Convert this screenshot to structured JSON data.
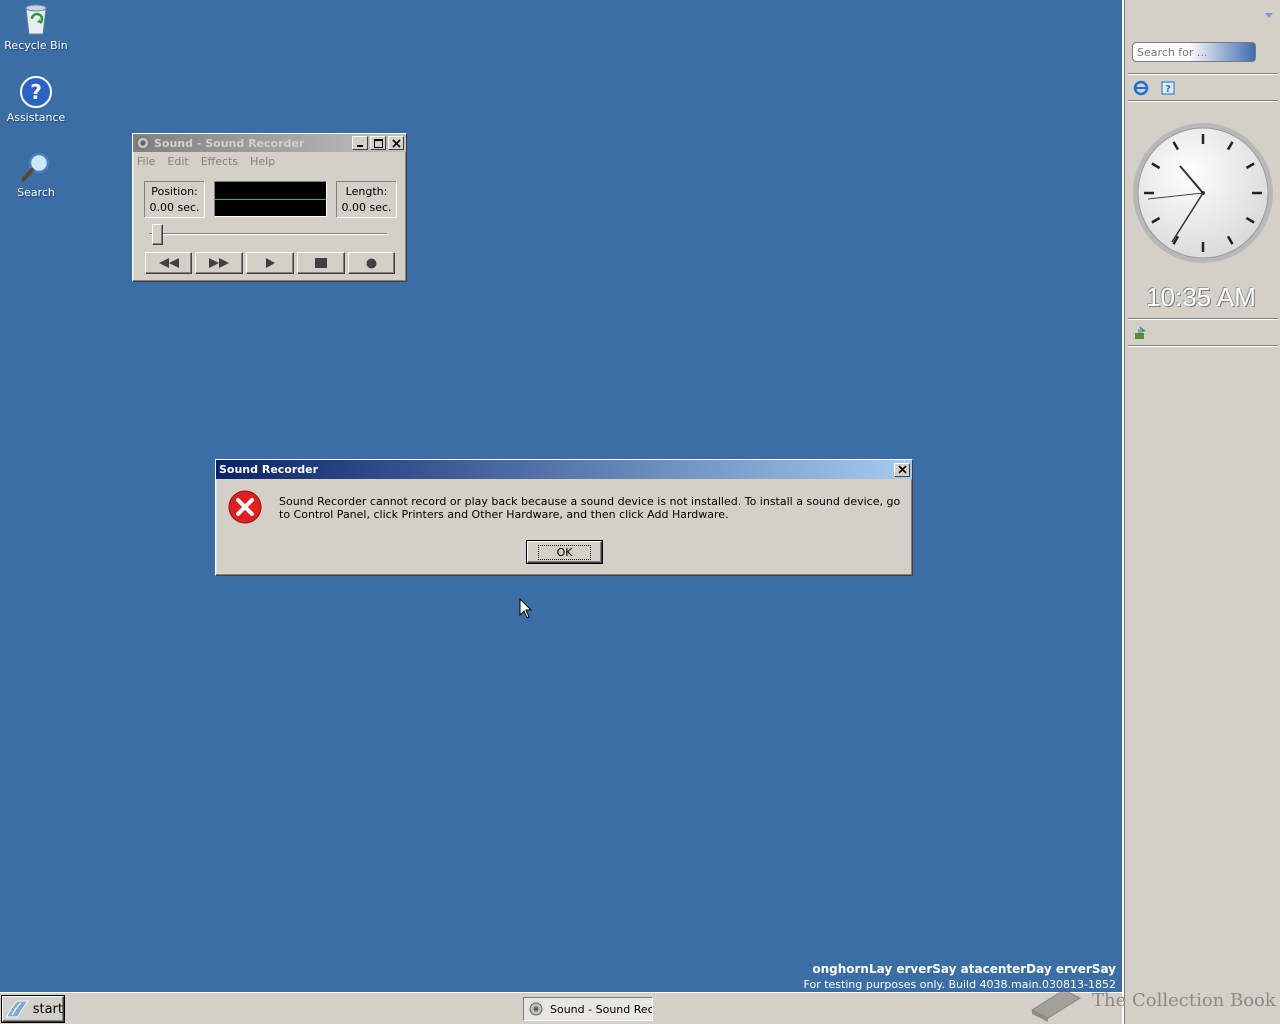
{
  "desktop": {
    "icons": [
      {
        "label": "Recycle Bin"
      },
      {
        "label": "Assistance"
      },
      {
        "label": "Search"
      }
    ],
    "background_color": "#3a6ea5"
  },
  "recorder": {
    "title": "Sound - Sound Recorder",
    "menu": [
      "File",
      "Edit",
      "Effects",
      "Help"
    ],
    "position_label": "Position:",
    "position_value": "0.00 sec.",
    "length_label": "Length:",
    "length_value": "0.00 sec.",
    "buttons": [
      "seek-start-icon",
      "seek-end-icon",
      "play-icon",
      "stop-icon",
      "record-icon"
    ]
  },
  "dialog": {
    "title": "Sound Recorder",
    "message": "Sound Recorder cannot record or play back because a sound device is not installed. To install a sound device, go to Control Panel, click Printers and Other Hardware, and then click Add Hardware.",
    "ok_label": "OK",
    "icon": "error-icon"
  },
  "sidebar": {
    "search_placeholder": "Search for ...",
    "time": "10:35 AM"
  },
  "taskbar": {
    "start_label": "start",
    "task_label": "Sound - Sound Recorder"
  },
  "watermark": {
    "line1": "onghornLay erverSay atacenterDay erverSay",
    "line2": "For testing purposes only. Build 4038.main.030813-1852",
    "brand": "The Collection Book"
  }
}
